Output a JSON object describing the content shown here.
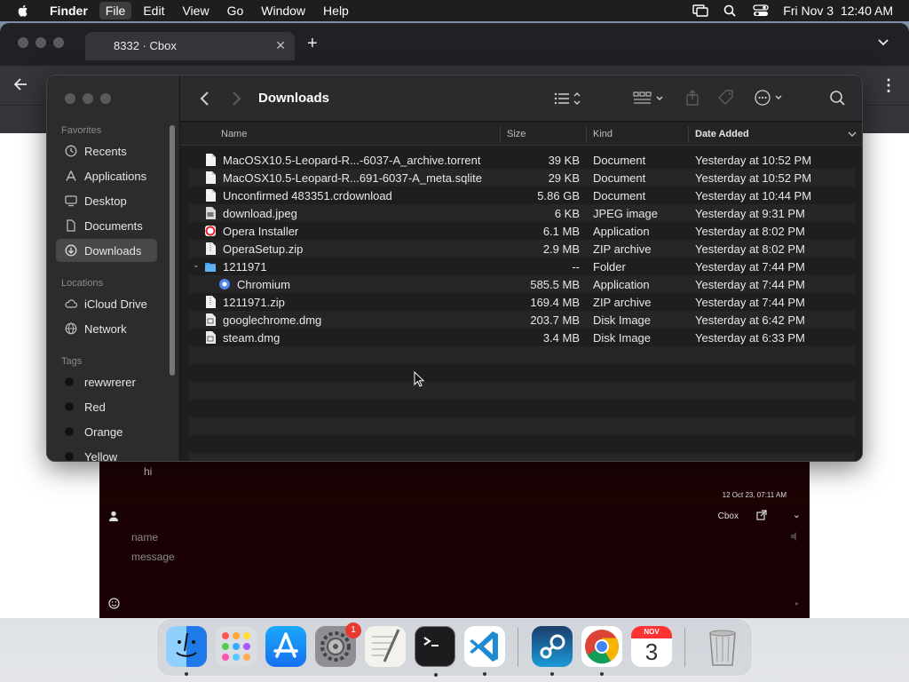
{
  "menubar": {
    "app_name": "Finder",
    "items": [
      "File",
      "Edit",
      "View",
      "Go",
      "Window",
      "Help"
    ],
    "clock": "Fri Nov 3  12:40 AM"
  },
  "browser": {
    "tab_title": "8332 · Cbox",
    "close_glyph": "✕",
    "new_tab_glyph": "+",
    "more_glyph": "⋮"
  },
  "chat": {
    "message_text": "hi",
    "timestamp": "12 Oct 23, 07:11 AM",
    "brand": "Cbox",
    "collapse_glyph": "⌄",
    "name_placeholder": "name",
    "message_placeholder": "message",
    "send_glyph": "▸"
  },
  "finder": {
    "title": "Downloads",
    "sidebar": {
      "favorites_label": "Favorites",
      "favorites": [
        "Recents",
        "Applications",
        "Desktop",
        "Documents",
        "Downloads"
      ],
      "locations_label": "Locations",
      "locations": [
        "iCloud Drive",
        "Network"
      ],
      "tags_label": "Tags",
      "tags": [
        "rewwrerer",
        "Red",
        "Orange",
        "Yellow"
      ]
    },
    "columns": {
      "name": "Name",
      "size": "Size",
      "kind": "Kind",
      "date": "Date Added"
    },
    "files": [
      {
        "name": "MacOSX10.5-Leopard-R...-6037-A_archive.torrent",
        "size": "39 KB",
        "kind": "Document",
        "date": "Yesterday at 10:52 PM",
        "icon": "doc"
      },
      {
        "name": "MacOSX10.5-Leopard-R...691-6037-A_meta.sqlite",
        "size": "29 KB",
        "kind": "Document",
        "date": "Yesterday at 10:52 PM",
        "icon": "doc"
      },
      {
        "name": "Unconfirmed 483351.crdownload",
        "size": "5.86 GB",
        "kind": "Document",
        "date": "Yesterday at 10:44 PM",
        "icon": "doc"
      },
      {
        "name": "download.jpeg",
        "size": "6 KB",
        "kind": "JPEG image",
        "date": "Yesterday at 9:31 PM",
        "icon": "image"
      },
      {
        "name": "Opera Installer",
        "size": "6.1 MB",
        "kind": "Application",
        "date": "Yesterday at 8:02 PM",
        "icon": "opera"
      },
      {
        "name": "OperaSetup.zip",
        "size": "2.9 MB",
        "kind": "ZIP archive",
        "date": "Yesterday at 8:02 PM",
        "icon": "zip"
      },
      {
        "name": "1211971",
        "size": "--",
        "kind": "Folder",
        "date": "Yesterday at 7:44 PM",
        "icon": "folder",
        "expanded": true
      },
      {
        "name": "Chromium",
        "size": "585.5 MB",
        "kind": "Application",
        "date": "Yesterday at 7:44 PM",
        "icon": "chromium",
        "child": true
      },
      {
        "name": "1211971.zip",
        "size": "169.4 MB",
        "kind": "ZIP archive",
        "date": "Yesterday at 7:44 PM",
        "icon": "zip"
      },
      {
        "name": "googlechrome.dmg",
        "size": "203.7 MB",
        "kind": "Disk Image",
        "date": "Yesterday at 6:42 PM",
        "icon": "dmg"
      },
      {
        "name": "steam.dmg",
        "size": "3.4 MB",
        "kind": "Disk Image",
        "date": "Yesterday at 6:33 PM",
        "icon": "dmg"
      }
    ]
  },
  "dock": {
    "apps": [
      "Finder",
      "Launchpad",
      "App Store",
      "System Settings",
      "TextEdit",
      "Terminal",
      "Visual Studio Code",
      "Steam",
      "Google Chrome",
      "Calendar",
      "Trash"
    ],
    "settings_badge": "1",
    "calendar_month": "NOV",
    "calendar_day": "3"
  },
  "colors": {
    "finder_bg": "#1e1e1e",
    "sidebar_bg": "#2c2c2f",
    "chat_bg": "#1e0305",
    "folder_blue": "#3b9cf0"
  }
}
